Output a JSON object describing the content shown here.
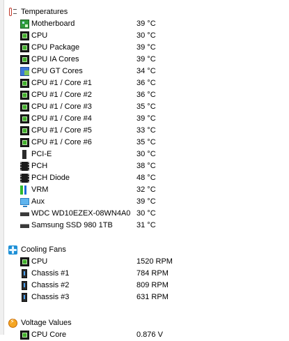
{
  "temperatures": {
    "label": "Temperatures",
    "icon": "thermometer-icon",
    "items": [
      {
        "label": "Motherboard",
        "value": "39 °C",
        "icon": "motherboard-icon"
      },
      {
        "label": "CPU",
        "value": "30 °C",
        "icon": "chip-icon"
      },
      {
        "label": "CPU Package",
        "value": "39 °C",
        "icon": "chip-icon"
      },
      {
        "label": "CPU IA Cores",
        "value": "39 °C",
        "icon": "chip-icon"
      },
      {
        "label": "CPU GT Cores",
        "value": "34 °C",
        "icon": "gpu-icon"
      },
      {
        "label": "CPU #1 / Core #1",
        "value": "36 °C",
        "icon": "chip-icon"
      },
      {
        "label": "CPU #1 / Core #2",
        "value": "36 °C",
        "icon": "chip-icon"
      },
      {
        "label": "CPU #1 / Core #3",
        "value": "35 °C",
        "icon": "chip-icon"
      },
      {
        "label": "CPU #1 / Core #4",
        "value": "39 °C",
        "icon": "chip-icon"
      },
      {
        "label": "CPU #1 / Core #5",
        "value": "33 °C",
        "icon": "chip-icon"
      },
      {
        "label": "CPU #1 / Core #6",
        "value": "35 °C",
        "icon": "chip-icon"
      },
      {
        "label": "PCI-E",
        "value": "30 °C",
        "icon": "pci-slot-icon"
      },
      {
        "label": "PCH",
        "value": "38 °C",
        "icon": "pch-chip-icon"
      },
      {
        "label": "PCH Diode",
        "value": "48 °C",
        "icon": "pch-chip-icon"
      },
      {
        "label": "VRM",
        "value": "32 °C",
        "icon": "vrm-icon"
      },
      {
        "label": "Aux",
        "value": "39 °C",
        "icon": "monitor-icon"
      },
      {
        "label": "WDC WD10EZEX-08WN4A0",
        "value": "30 °C",
        "icon": "hard-disk-icon"
      },
      {
        "label": "Samsung SSD 980 1TB",
        "value": "31 °C",
        "icon": "ssd-icon"
      }
    ]
  },
  "cooling_fans": {
    "label": "Cooling Fans",
    "icon": "fan-icon",
    "items": [
      {
        "label": "CPU",
        "value": "1520 RPM",
        "icon": "chip-icon"
      },
      {
        "label": "Chassis #1",
        "value": "784 RPM",
        "icon": "chassis-icon"
      },
      {
        "label": "Chassis #2",
        "value": "809 RPM",
        "icon": "chassis-icon"
      },
      {
        "label": "Chassis #3",
        "value": "631 RPM",
        "icon": "chassis-icon"
      }
    ]
  },
  "voltage_values": {
    "label": "Voltage Values",
    "icon": "voltage-icon",
    "items": [
      {
        "label": "CPU Core",
        "value": "0.876 V",
        "icon": "chip-icon"
      }
    ]
  }
}
